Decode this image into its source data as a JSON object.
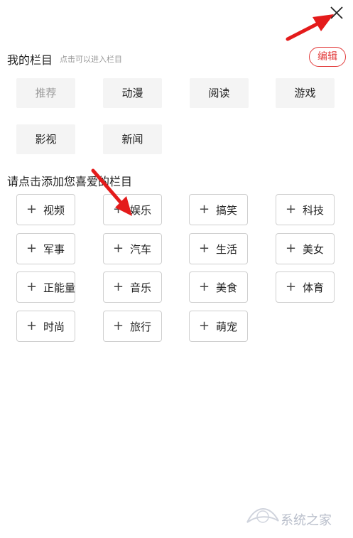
{
  "header": {
    "close_icon": "close-icon"
  },
  "my_columns": {
    "title": "我的栏目",
    "hint": "点击可以进入栏目",
    "edit_label": "编辑",
    "items": [
      "推荐",
      "动漫",
      "阅读",
      "游戏",
      "影视",
      "新闻"
    ]
  },
  "add_columns": {
    "title": "请点击添加您喜爱的栏目",
    "plus_icon": "plus-icon",
    "items": [
      "视频",
      "娱乐",
      "搞笑",
      "科技",
      "军事",
      "汽车",
      "生活",
      "美女",
      "正能量",
      "音乐",
      "美食",
      "体育",
      "时尚",
      "旅行",
      "萌宠"
    ]
  },
  "watermark": {
    "text": "系统之家"
  },
  "colors": {
    "accent": "#e23b3b",
    "annotation_arrow": "#e41b1b"
  }
}
